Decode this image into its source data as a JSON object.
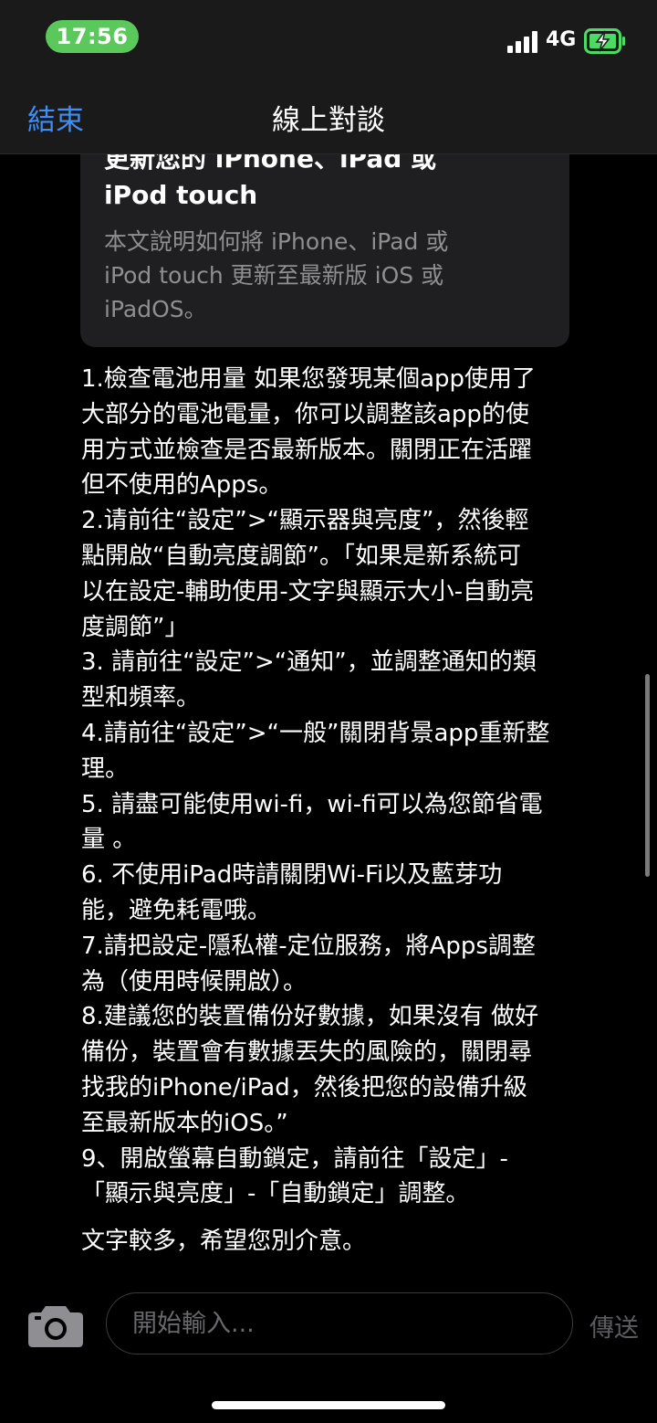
{
  "status_bar": {
    "time": "17:56",
    "network": "4G"
  },
  "nav": {
    "end_label": "結束",
    "title": "線上對談"
  },
  "article_card": {
    "title": "更新您的 iPhone、iPad 或 iPod touch",
    "title_lines": [
      "更新您的 iPhone、iPad 或",
      "iPod touch"
    ],
    "description_lines": [
      "本文說明如何將 iPhone、iPad 或",
      "iPod touch 更新至最新版 iOS 或",
      "iPadOS。"
    ]
  },
  "agent_message_lines": [
    "1.檢查電池用量 如果您發現某個app使用了",
    "大部分的電池電量，你可以調整該app的使",
    "用方式並檢查是否最新版本。關閉正在活躍",
    "但不使用的Apps。",
    " 2.请前往“設定”>“顯示器與亮度”，然後輕",
    "點開啟“自動亮度調節”。「如果是新系統可",
    "以在設定-輔助使用-文字與顯示大小-自動亮",
    "度調節”」",
    "3. 請前往“設定”>“通知”，並調整通知的類",
    "型和頻率。",
    "4.請前往“設定”>“一般”關閉背景app重新整",
    "理。",
    "5. 請盡可能使用wi-fi，wi-fi可以為您節省電",
    "量 。",
    "6. 不使用iPad時請關閉Wi-Fi以及藍芽功",
    "能，避免耗電哦。",
    "7.請把設定-隱私權-定位服務，將Apps調整",
    "為（使用時候開啟）。",
    "8.建議您的裝置備份好數據，如果沒有 做好",
    "備份，裝置會有數據丟失的風險的，關閉尋",
    "找我的iPhone/iPad，然後把您的設備升級",
    "至最新版本的iOS。”",
    "9、開啟螢幕自動鎖定，請前往「設定」-",
    "「顯示與亮度」-「自動鎖定」調整。"
  ],
  "followup_message": "文字較多，希望您別介意。",
  "composer": {
    "placeholder": "開始輸入...",
    "send_label": "傳送"
  },
  "colors": {
    "accent": "#3d8ef7",
    "time_pill": "#5ac85a",
    "battery_charge": "#4cd964",
    "card_background": "#1f1f21",
    "secondary_text": "#8e8e93"
  },
  "icons": [
    "signal-icon",
    "battery-charging-icon",
    "camera-icon"
  ]
}
